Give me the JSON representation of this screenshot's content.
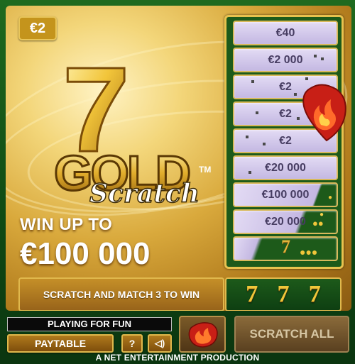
{
  "price_badge": "€2",
  "logo": {
    "word1": "GOLD",
    "word2": "Scratch",
    "tm": "TM",
    "big_digit": "7"
  },
  "tagline": {
    "line1": "WIN UP TO",
    "line2": "€100 000"
  },
  "ticket_cells": [
    {
      "prize": "€40",
      "state": "covered"
    },
    {
      "prize": "€2 000",
      "state": "covered"
    },
    {
      "prize": "€2",
      "state": "covered"
    },
    {
      "prize": "€2",
      "state": "covered"
    },
    {
      "prize": "€2",
      "state": "covered"
    },
    {
      "prize": "€20 000",
      "state": "covered"
    },
    {
      "prize": "€100 000",
      "state": "partially-scratched"
    },
    {
      "prize": "€20 000",
      "state": "partially-scratched"
    },
    {
      "prize": "",
      "state": "scratched"
    }
  ],
  "instruction": "SCRATCH AND MATCH 3 TO WIN",
  "match_symbols": [
    "7",
    "7",
    "7"
  ],
  "status": "PLAYING FOR FUN",
  "buttons": {
    "paytable": "PAYTABLE",
    "help": "?",
    "sound": "◁)",
    "scratch_all": "SCRATCH ALL"
  },
  "footer": "A NET ENTERTAINMENT PRODUCTION",
  "colors": {
    "gold": "#e0b84c",
    "board_green": "#1d5a1a",
    "cell_lavender": "#d2c8ea",
    "flame_red": "#d7261b"
  }
}
